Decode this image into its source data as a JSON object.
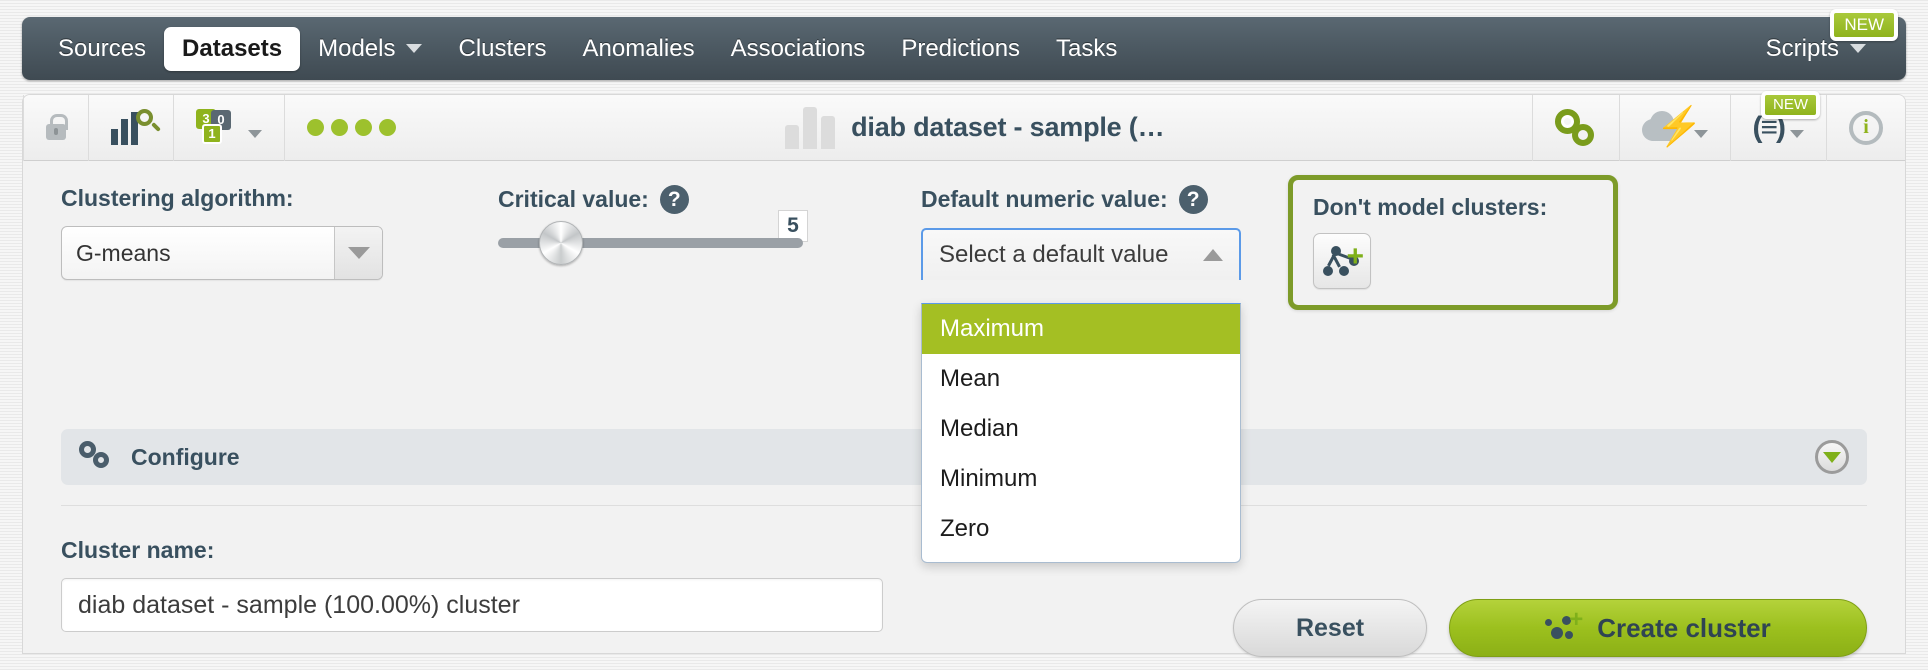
{
  "nav": {
    "items": [
      {
        "label": "Sources",
        "active": false,
        "caret": false
      },
      {
        "label": "Datasets",
        "active": true,
        "caret": false
      },
      {
        "label": "Models",
        "active": false,
        "caret": true
      },
      {
        "label": "Clusters",
        "active": false,
        "caret": false
      },
      {
        "label": "Anomalies",
        "active": false,
        "caret": false
      },
      {
        "label": "Associations",
        "active": false,
        "caret": false
      },
      {
        "label": "Predictions",
        "active": false,
        "caret": false
      },
      {
        "label": "Tasks",
        "active": false,
        "caret": false
      }
    ],
    "scripts_label": "Scripts",
    "new_badge": "NEW"
  },
  "toolbar": {
    "title": "diab dataset - sample (…",
    "lock_icon": "lock-icon",
    "histogram_icon": "histogram-search-icon",
    "fields_icon": "field-types-icon",
    "status_dots": 4,
    "config_icon": "gears-icon",
    "cloud_icon": "cloud-bolt-icon",
    "script_icon": "script-icon",
    "info_icon": "info-icon",
    "new_badge": "NEW"
  },
  "form": {
    "algorithm": {
      "label": "Clustering algorithm:",
      "value": "G-means"
    },
    "critical_value": {
      "label": "Critical value:",
      "help": "?",
      "value": "5",
      "slider_percent": 17
    },
    "default_numeric": {
      "label": "Default numeric value:",
      "help": "?",
      "placeholder": "Select a default value",
      "options": [
        "Maximum",
        "Mean",
        "Median",
        "Minimum",
        "Zero"
      ],
      "highlighted": "Maximum",
      "highlight_color": "#a4bf23"
    },
    "dont_model_clusters": {
      "label": "Don't model clusters:",
      "button_icon": "model-cluster-add-icon",
      "border_color": "#7d9b29"
    }
  },
  "configure": {
    "label": "Configure",
    "gear_icon": "gears-icon",
    "collapse_icon": "chevron-down-circle-icon"
  },
  "bottom": {
    "cluster_name_label": "Cluster name:",
    "cluster_name_value": "diab dataset - sample (100.00%) cluster",
    "reset_label": "Reset",
    "create_label": "Create cluster",
    "create_color": "#9cc01e"
  }
}
